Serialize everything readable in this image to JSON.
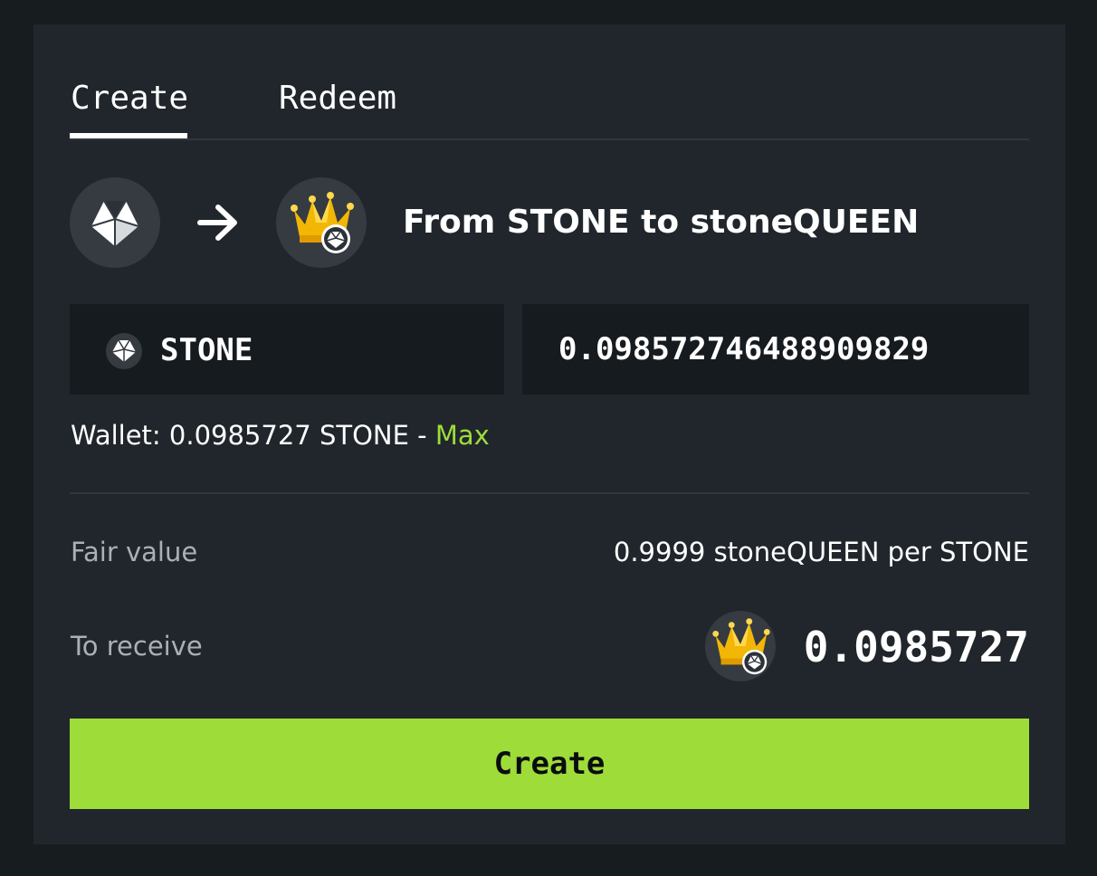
{
  "tabs": {
    "create": "Create",
    "redeem": "Redeem"
  },
  "header": {
    "from_token": "STONE",
    "to_token": "stoneQUEEN",
    "title": "From STONE to stoneQUEEN"
  },
  "input": {
    "token_label": "STONE",
    "amount": "0.098572746488909829"
  },
  "wallet": {
    "prefix": "Wallet: 0.0985727 STONE - ",
    "max_label": "Max"
  },
  "fair_value": {
    "label": "Fair value",
    "value": "0.9999 stoneQUEEN per STONE"
  },
  "receive": {
    "label": "To receive",
    "amount": "0.0985727"
  },
  "button": {
    "label": "Create"
  },
  "colors": {
    "accent": "#9edc3a",
    "background": "#171c1f",
    "card": "#20262c",
    "input": "#161b1f"
  },
  "icons": {
    "stone": "stone-icon",
    "queen": "crown-icon",
    "arrow": "arrow-right-icon"
  }
}
